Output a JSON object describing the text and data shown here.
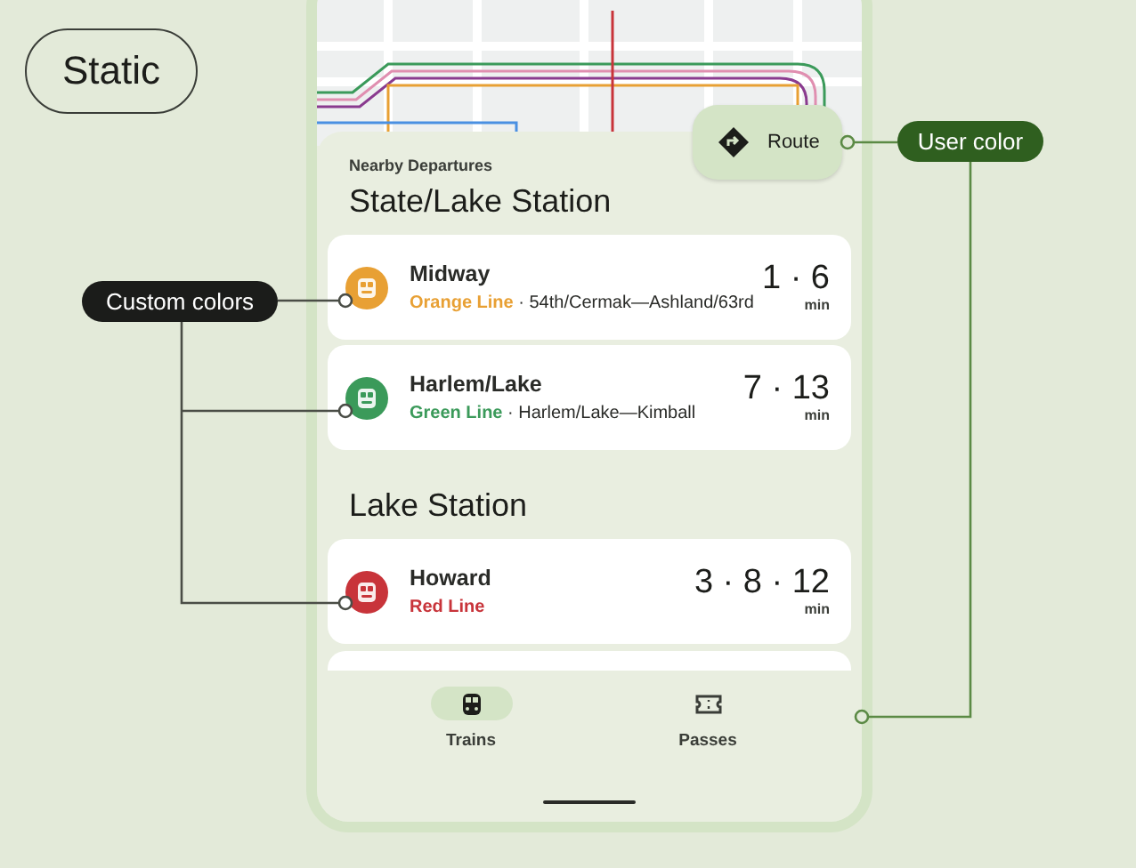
{
  "static_label": "Static",
  "annotations": {
    "custom_colors": "Custom colors",
    "user_color": "User color"
  },
  "route_button": {
    "label": "Route"
  },
  "sheet": {
    "heading": "Nearby Departures",
    "stations": [
      {
        "name": "State/Lake Station",
        "departures": [
          {
            "destination": "Midway",
            "line": "Orange Line",
            "color": "#e8a034",
            "via": "· 54th/Cermak—Ashland/63rd",
            "times": "1 · 6",
            "unit": "min"
          },
          {
            "destination": "Harlem/Lake",
            "line": "Green Line",
            "color": "#3b9a5a",
            "via": "· Harlem/Lake—Kimball",
            "times": "7 · 13",
            "unit": "min"
          }
        ]
      },
      {
        "name": "Lake Station",
        "departures": [
          {
            "destination": "Howard",
            "line": "Red Line",
            "color": "#c8343a",
            "times": "3 · 8 · 12",
            "unit": "min"
          }
        ]
      }
    ]
  },
  "nav": [
    {
      "label": "Trains",
      "kind": "train",
      "selected": true
    },
    {
      "label": "Passes",
      "kind": "ticket",
      "selected": false
    }
  ]
}
